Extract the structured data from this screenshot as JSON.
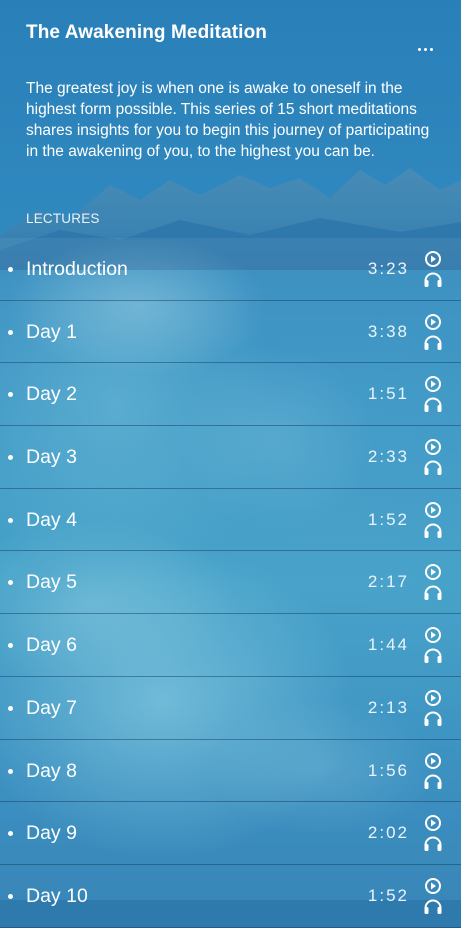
{
  "header": {
    "title": "The Awakening Meditation",
    "description": "The greatest joy is when one is awake to oneself in the highest form possible. This series of 15 short meditations shares insights for you to begin this journey of participating in the awakening of you, to the highest you can be.",
    "more_icon": "more-horizontal-icon",
    "section_label": "LECTURES"
  },
  "lectures": [
    {
      "name": "Introduction",
      "duration": "3:23",
      "icon": "play-listen-icon"
    },
    {
      "name": "Day 1",
      "duration": "3:38",
      "icon": "play-listen-icon"
    },
    {
      "name": "Day 2",
      "duration": "1:51",
      "icon": "play-listen-icon"
    },
    {
      "name": "Day 3",
      "duration": "2:33",
      "icon": "play-listen-icon"
    },
    {
      "name": "Day 4",
      "duration": "1:52",
      "icon": "play-listen-icon"
    },
    {
      "name": "Day 5",
      "duration": "2:17",
      "icon": "play-listen-icon"
    },
    {
      "name": "Day 6",
      "duration": "1:44",
      "icon": "play-listen-icon"
    },
    {
      "name": "Day 7",
      "duration": "2:13",
      "icon": "play-listen-icon"
    },
    {
      "name": "Day 8",
      "duration": "1:56",
      "icon": "play-listen-icon"
    },
    {
      "name": "Day 9",
      "duration": "2:02",
      "icon": "play-listen-icon"
    },
    {
      "name": "Day 10",
      "duration": "1:52",
      "icon": "play-listen-icon"
    }
  ],
  "colors": {
    "background": "#2f89bf",
    "divider": "#0f375a",
    "text": "#ffffff"
  }
}
